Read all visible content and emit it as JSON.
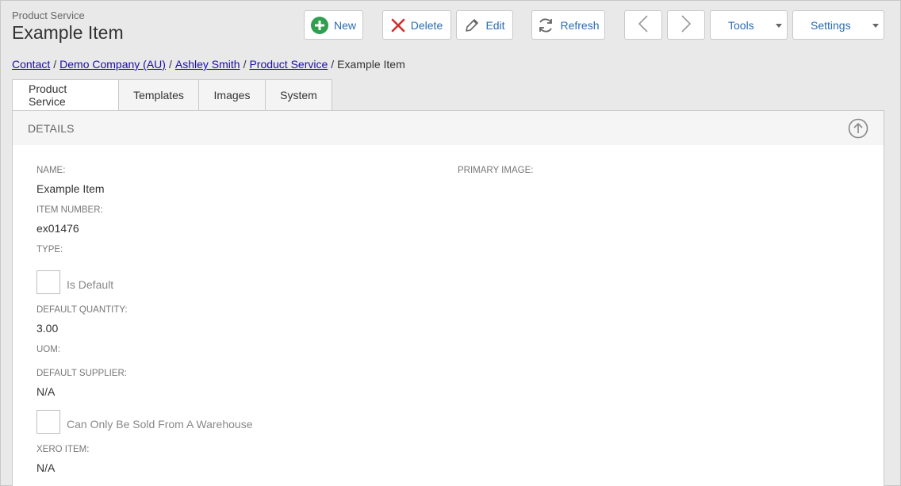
{
  "header": {
    "subtitle": "Product Service",
    "title": "Example Item"
  },
  "toolbar": {
    "new_label": "New",
    "delete_label": "Delete",
    "edit_label": "Edit",
    "refresh_label": "Refresh",
    "tools_label": "Tools",
    "settings_label": "Settings"
  },
  "breadcrumb": {
    "items": [
      "Contact",
      "Demo Company (AU)",
      "Ashley Smith",
      "Product Service"
    ],
    "current": "Example Item",
    "separator": "/"
  },
  "tabs": [
    "Product Service",
    "Templates",
    "Images",
    "System"
  ],
  "details": {
    "heading": "DETAILS",
    "name_label": "NAME:",
    "name_value": "Example Item",
    "item_number_label": "ITEM NUMBER:",
    "item_number_value": "ex01476",
    "type_label": "TYPE:",
    "is_default_label": "Is Default",
    "default_quantity_label": "DEFAULT QUANTITY:",
    "default_quantity_value": "3.00",
    "uom_label": "UOM:",
    "default_supplier_label": "DEFAULT SUPPLIER:",
    "default_supplier_value": "N/A",
    "warehouse_label": "Can Only Be Sold From A Warehouse",
    "xero_item_label": "XERO ITEM:",
    "xero_item_value": "N/A",
    "primary_image_label": "PRIMARY IMAGE:"
  },
  "colors": {
    "accent": "#2b6cb0",
    "new_icon": "#2e9e4f",
    "delete_icon": "#d32f2f"
  }
}
